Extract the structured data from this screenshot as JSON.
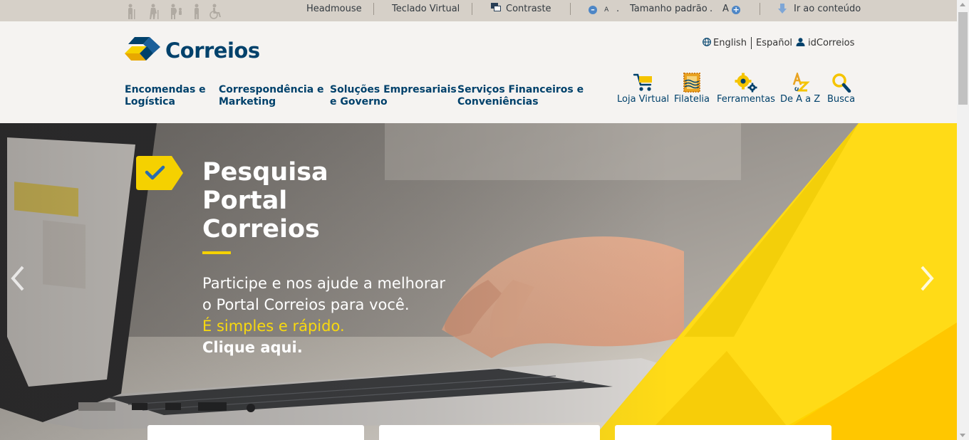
{
  "accessibility": {
    "headmouse": "Headmouse",
    "teclado_virtual": "Teclado Virtual",
    "contraste": "Contraste",
    "font_decrease": "A",
    "dot_left": ".",
    "tamanho_padrao": "Tamanho padrão",
    "dot_right": ".",
    "font_increase": "A",
    "ir_ao_conteudo": "Ir ao conteúdo"
  },
  "brand": {
    "name": "Correios",
    "blue": "#00416b",
    "yellow": "#f5d100"
  },
  "languages": {
    "english": "English",
    "espanol": "Español",
    "account": "idCorreios"
  },
  "nav": [
    {
      "line1": "Encomendas e",
      "line2": "Logística"
    },
    {
      "line1": "Correspondência e",
      "line2": "Marketing"
    },
    {
      "line1": "Soluções Empresariais",
      "line2": "e Governo"
    },
    {
      "line1": "Serviços Financeiros e",
      "line2": "Conveniências"
    }
  ],
  "tools": {
    "loja_virtual": "Loja Virtual",
    "filatelia": "Filatelia",
    "ferramentas": "Ferramentas",
    "de_a_a_z": "De A a Z",
    "busca": "Busca"
  },
  "hero": {
    "title_line1": "Pesquisa",
    "title_line2": "Portal",
    "title_line3": "Correios",
    "text_line1": "Participe e nos ajude a melhorar",
    "text_line2": "o Portal Correios para você.",
    "highlight": "É simples e rápido.",
    "cta": "Clique aqui."
  },
  "icons": {
    "accessibility_people": "people-icons",
    "contrast": "contrast-icon",
    "globe": "globe-icon",
    "user": "user-icon",
    "cart": "cart-icon",
    "stamps": "stamp-icon",
    "gears": "gears-icon",
    "az": "az-icon",
    "search": "search-icon",
    "check": "check-icon",
    "prev": "chevron-left-icon",
    "next": "chevron-right-icon"
  }
}
